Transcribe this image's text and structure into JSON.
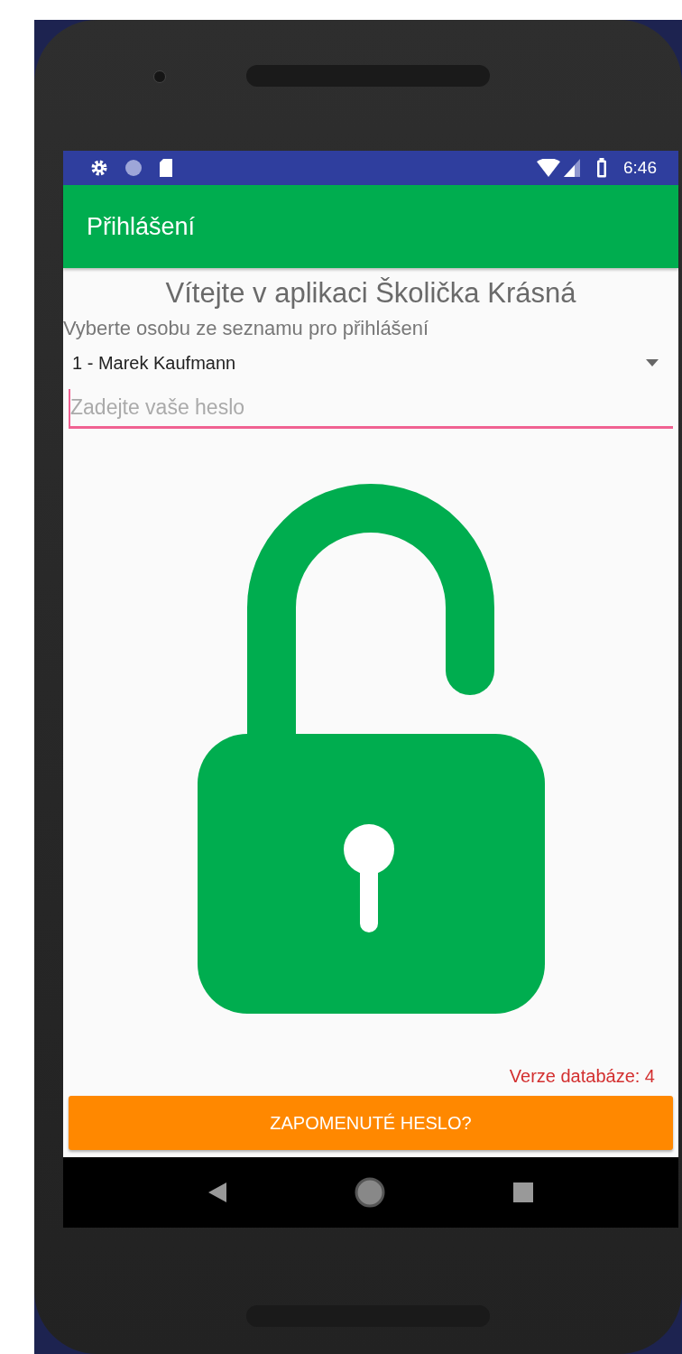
{
  "status_bar": {
    "time": "6:46"
  },
  "app_bar": {
    "title": "Přihlášení"
  },
  "welcome": "Vítejte v aplikaci Školička Krásná",
  "person_label": "Vyberte osobu ze seznamu pro přihlášení",
  "person_select": {
    "value": "1 - Marek Kaufmann"
  },
  "password_field": {
    "placeholder": "Zadejte vaše heslo",
    "focused": true
  },
  "database_version": "Verze databáze: 4",
  "forgot_password_button": {
    "label": "ZAPOMENUTÉ HESLO?"
  }
}
